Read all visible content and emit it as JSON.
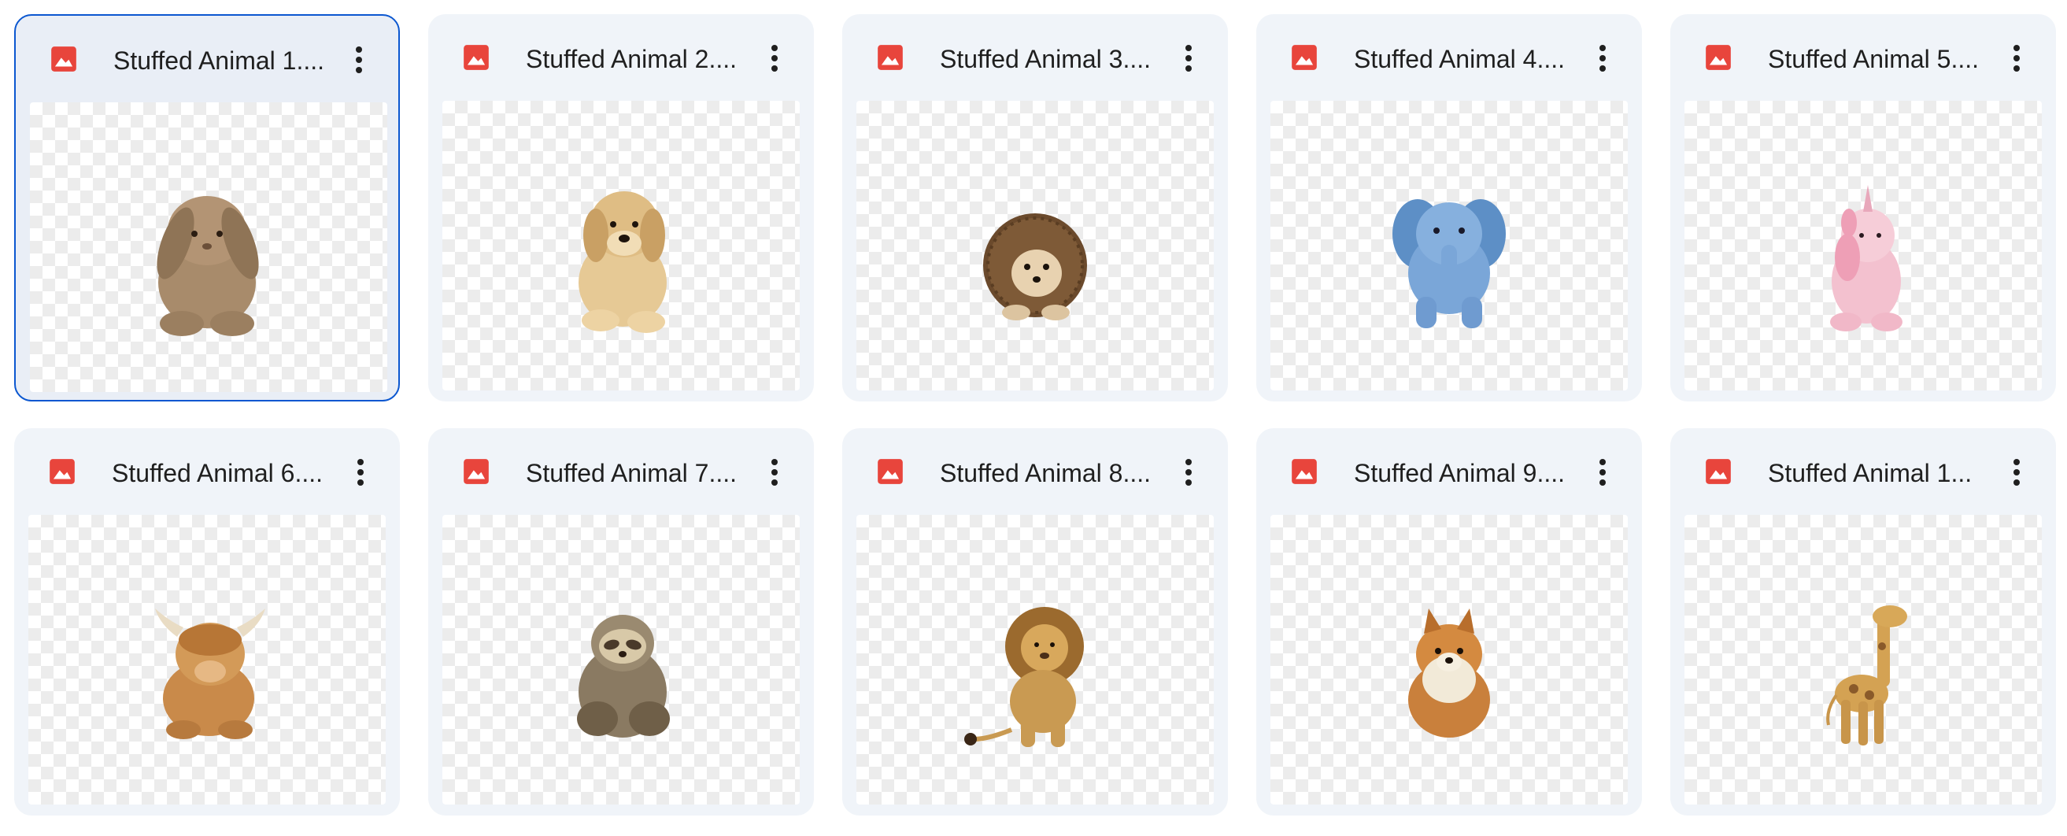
{
  "icons": {
    "file_type": "image-file-icon",
    "menu": "more-vert-icon"
  },
  "colors": {
    "file_icon": "#e8453c",
    "card_bg": "#f0f4f9",
    "selected_border": "#0b57d0"
  },
  "files": [
    {
      "name": "Stuffed Animal 1....",
      "selected": true,
      "toy": "bunny"
    },
    {
      "name": "Stuffed Animal 2....",
      "selected": false,
      "toy": "puppy"
    },
    {
      "name": "Stuffed Animal 3....",
      "selected": false,
      "toy": "hedgehog"
    },
    {
      "name": "Stuffed Animal 4....",
      "selected": false,
      "toy": "elephant"
    },
    {
      "name": "Stuffed Animal 5....",
      "selected": false,
      "toy": "unicorn"
    },
    {
      "name": "Stuffed Animal 6....",
      "selected": false,
      "toy": "highland-cow"
    },
    {
      "name": "Stuffed Animal 7....",
      "selected": false,
      "toy": "sloth"
    },
    {
      "name": "Stuffed Animal 8....",
      "selected": false,
      "toy": "lion"
    },
    {
      "name": "Stuffed Animal 9....",
      "selected": false,
      "toy": "pomeranian"
    },
    {
      "name": "Stuffed Animal 1...",
      "selected": false,
      "toy": "giraffe"
    }
  ]
}
